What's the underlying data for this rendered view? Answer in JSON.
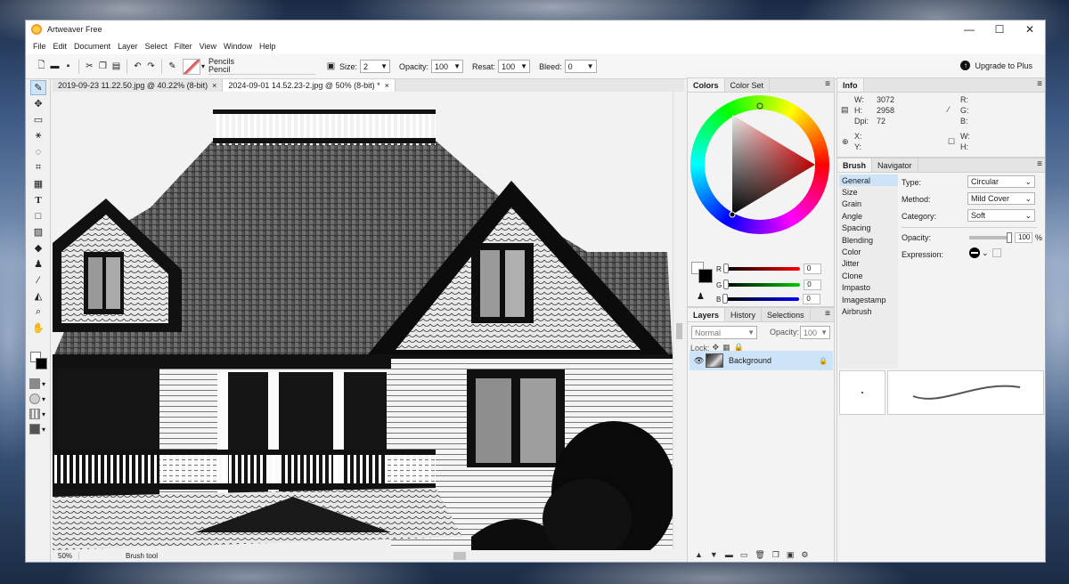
{
  "window": {
    "title": "Artweaver Free",
    "minimize": "—",
    "maximize": "☐",
    "close": "✕"
  },
  "menu": [
    "File",
    "Edit",
    "Document",
    "Layer",
    "Select",
    "Filter",
    "View",
    "Window",
    "Help"
  ],
  "toolbar": {
    "preset_category": "Pencils",
    "preset_name": "Pencil",
    "size_label": "Size:",
    "size_value": "2",
    "opacity_label": "Opacity:",
    "opacity_value": "100",
    "resat_label": "Resat:",
    "resat_value": "100",
    "bleed_label": "Bleed:",
    "bleed_value": "0",
    "upgrade_label": "Upgrade to Plus"
  },
  "documents": [
    {
      "title": "2019-09-23 11.22.50.jpg @ 40.22% (8-bit)",
      "active": false
    },
    {
      "title": "2024-09-01 14.52.23-2.jpg @ 50% (8-bit) *",
      "active": true
    }
  ],
  "status": {
    "zoom": "50%",
    "tool": "Brush tool"
  },
  "colors_panel": {
    "tabs": [
      "Colors",
      "Color Set"
    ],
    "channels": [
      {
        "label": "R",
        "value": "0",
        "color": "#e01010"
      },
      {
        "label": "G",
        "value": "0",
        "color": "#10b010"
      },
      {
        "label": "B",
        "value": "0",
        "color": "#1030e0"
      }
    ]
  },
  "layers_panel": {
    "tabs": [
      "Layers",
      "History",
      "Selections"
    ],
    "blend_mode": "Normal",
    "opacity_label": "Opacity:",
    "opacity_value": "100",
    "lock_label": "Lock:",
    "layer_name": "Background"
  },
  "info_panel": {
    "tab": "Info",
    "w_label": "W:",
    "w_value": "3072",
    "h_label": "H:",
    "h_value": "2958",
    "dpi_label": "Dpi:",
    "dpi_value": "72",
    "r_label": "R:",
    "g_label": "G:",
    "b_label": "B:",
    "x_label": "X:",
    "y_label": "Y:",
    "sel_w_label": "W:",
    "sel_h_label": "H:"
  },
  "brush_panel": {
    "tabs": [
      "Brush",
      "Navigator"
    ],
    "categories": [
      "General",
      "Size",
      "Grain",
      "Angle",
      "Spacing",
      "Blending",
      "Color",
      "Jitter",
      "Clone",
      "Impasto",
      "Imagestamp",
      "Airbrush"
    ],
    "type_label": "Type:",
    "type_value": "Circular",
    "method_label": "Method:",
    "method_value": "Mild Cover",
    "category_label": "Category:",
    "category_value": "Soft",
    "opacity_label": "Opacity:",
    "opacity_value": "100",
    "opacity_unit": "%",
    "opacity_fraction": 1.0,
    "expression_label": "Expression:"
  }
}
